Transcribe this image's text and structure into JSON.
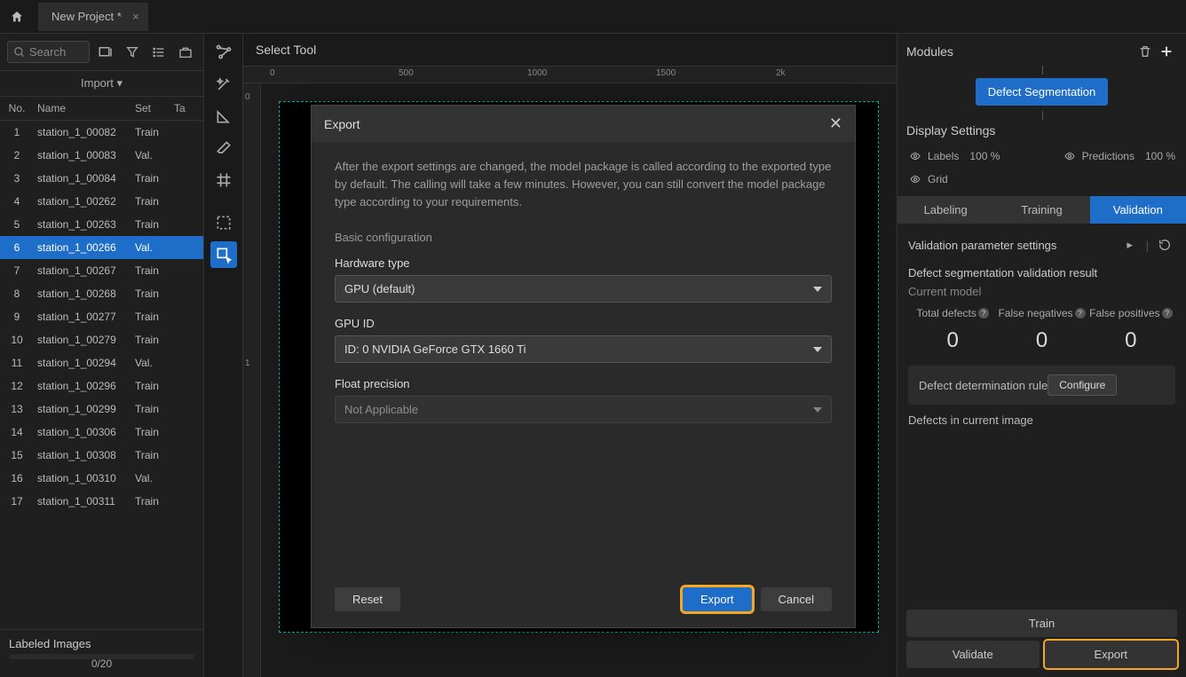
{
  "topbar": {
    "project_tab": "New Project *"
  },
  "left": {
    "search_placeholder": "Search",
    "import_label": "Import",
    "columns": {
      "no": "No.",
      "name": "Name",
      "set": "Set",
      "tag": "Ta"
    },
    "files": [
      {
        "no": 1,
        "name": "station_1_00082",
        "set": "Train"
      },
      {
        "no": 2,
        "name": "station_1_00083",
        "set": "Val."
      },
      {
        "no": 3,
        "name": "station_1_00084",
        "set": "Train"
      },
      {
        "no": 4,
        "name": "station_1_00262",
        "set": "Train"
      },
      {
        "no": 5,
        "name": "station_1_00263",
        "set": "Train"
      },
      {
        "no": 6,
        "name": "station_1_00266",
        "set": "Val.",
        "selected": true
      },
      {
        "no": 7,
        "name": "station_1_00267",
        "set": "Train"
      },
      {
        "no": 8,
        "name": "station_1_00268",
        "set": "Train"
      },
      {
        "no": 9,
        "name": "station_1_00277",
        "set": "Train"
      },
      {
        "no": 10,
        "name": "station_1_00279",
        "set": "Train"
      },
      {
        "no": 11,
        "name": "station_1_00294",
        "set": "Val."
      },
      {
        "no": 12,
        "name": "station_1_00296",
        "set": "Train"
      },
      {
        "no": 13,
        "name": "station_1_00299",
        "set": "Train"
      },
      {
        "no": 14,
        "name": "station_1_00306",
        "set": "Train"
      },
      {
        "no": 15,
        "name": "station_1_00308",
        "set": "Train"
      },
      {
        "no": 16,
        "name": "station_1_00310",
        "set": "Val."
      },
      {
        "no": 17,
        "name": "station_1_00311",
        "set": "Train"
      }
    ],
    "labeled_title": "Labeled Images",
    "labeled_progress": "0/20"
  },
  "center": {
    "tool_header": "Select Tool",
    "ruler_marks": [
      "0",
      "500",
      "1000",
      "1500",
      "2k"
    ],
    "ruler_v": [
      "0",
      "1"
    ]
  },
  "right": {
    "modules_title": "Modules",
    "module_chip": "Defect Segmentation",
    "display_title": "Display Settings",
    "labels": "Labels",
    "labels_pct": "100 %",
    "predictions": "Predictions",
    "predictions_pct": "100 %",
    "grid": "Grid",
    "tabs": {
      "labeling": "Labeling",
      "training": "Training",
      "validation": "Validation"
    },
    "param_title": "Validation parameter settings",
    "result_title": "Defect segmentation validation result",
    "current_model": "Current model",
    "metrics": {
      "total_defects": "Total defects",
      "total_defects_val": "0",
      "false_neg": "False negatives",
      "false_neg_val": "0",
      "false_pos": "False positives",
      "false_pos_val": "0"
    },
    "rule_label": "Defect determination rule",
    "configure": "Configure",
    "defects_in_img": "Defects in current image",
    "train_btn": "Train",
    "validate_btn": "Validate",
    "export_btn": "Export"
  },
  "modal": {
    "title": "Export",
    "description": "After the export settings are changed, the model package is called according to the exported type by default. The calling will take a few minutes. However, you can still convert the model package type according to your requirements.",
    "section": "Basic configuration",
    "hw_label": "Hardware type",
    "hw_value": "GPU (default)",
    "gpu_label": "GPU ID",
    "gpu_value": "ID: 0  NVIDIA GeForce GTX 1660 Ti",
    "float_label": "Float precision",
    "float_value": "Not Applicable",
    "reset": "Reset",
    "export": "Export",
    "cancel": "Cancel"
  }
}
